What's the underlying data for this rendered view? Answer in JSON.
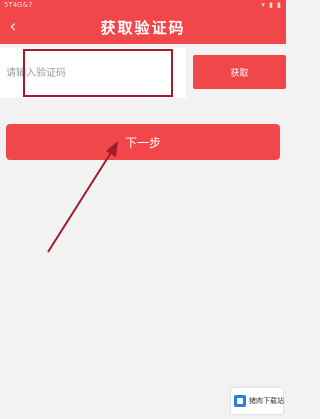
{
  "status_bar": {
    "left_text": "5T4G&7",
    "right_text": "▾ ▮ ▮"
  },
  "header": {
    "back_glyph": "‹",
    "title": "获取验证码"
  },
  "code_input": {
    "value": "",
    "placeholder": "请输入验证码"
  },
  "send_button": {
    "label": "获取"
  },
  "next_button": {
    "label": "下一步"
  },
  "watermark": {
    "text": "猪肉下载站"
  },
  "colors": {
    "accent": "#f2474a",
    "annotation": "#a31a2a",
    "background": "#f2f2f2"
  }
}
